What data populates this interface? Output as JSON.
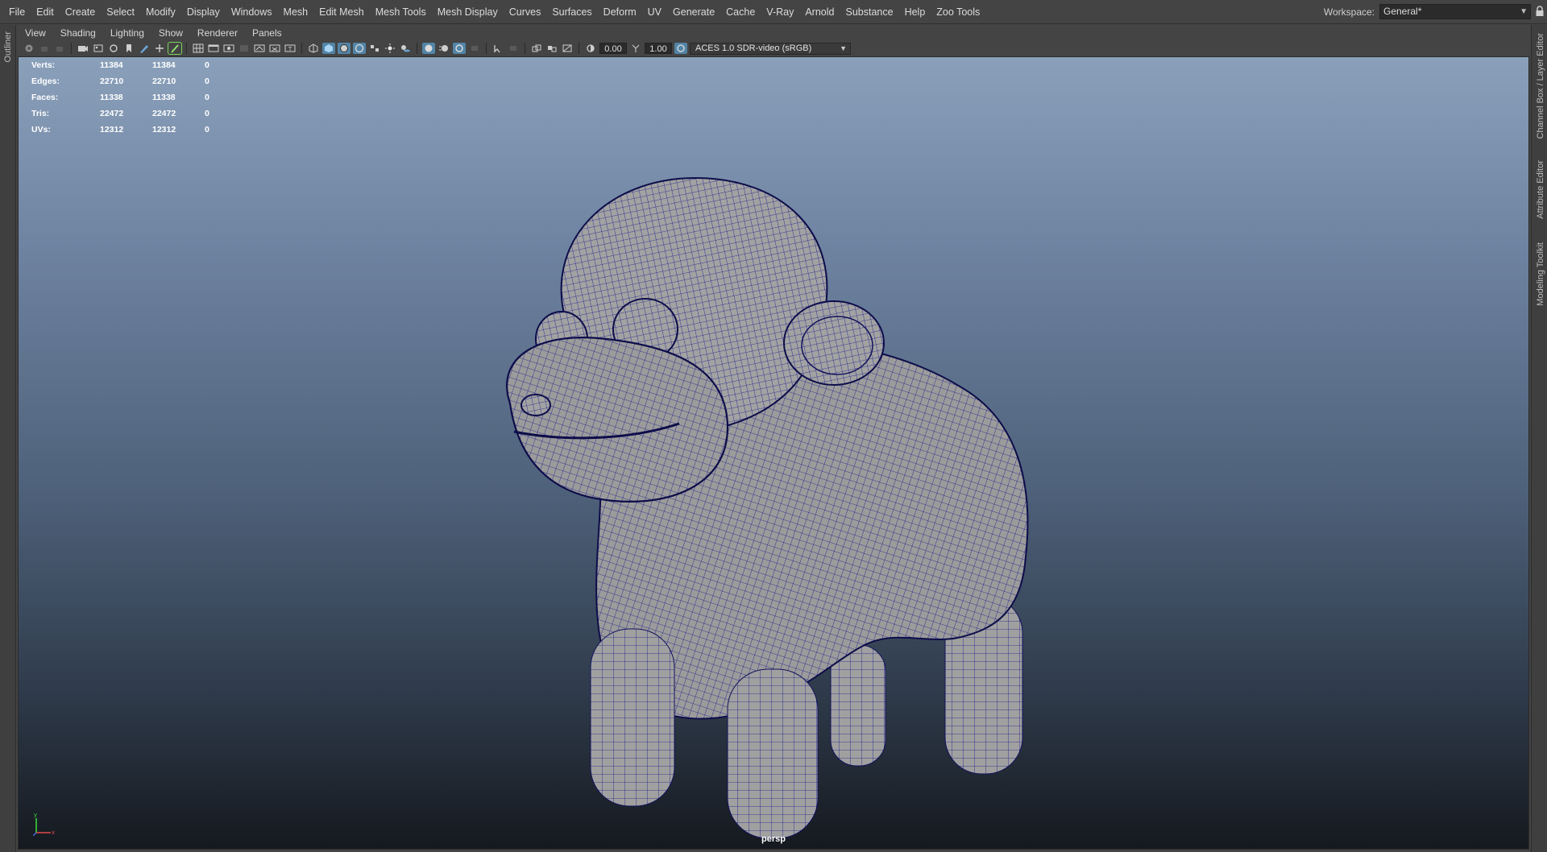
{
  "menubar": {
    "items": [
      "File",
      "Edit",
      "Create",
      "Select",
      "Modify",
      "Display",
      "Windows",
      "Mesh",
      "Edit Mesh",
      "Mesh Tools",
      "Mesh Display",
      "Curves",
      "Surfaces",
      "Deform",
      "UV",
      "Generate",
      "Cache",
      "V-Ray",
      "Arnold",
      "Substance",
      "Help",
      "Zoo Tools"
    ],
    "workspace_label": "Workspace:",
    "workspace_value": "General*"
  },
  "left_strip": {
    "tab_label": "Outliner"
  },
  "right_strip": {
    "tabs": [
      "Channel Box / Layer Editor",
      "Attribute Editor",
      "Modeling Toolkit"
    ]
  },
  "panel_menu": {
    "items": [
      "View",
      "Shading",
      "Lighting",
      "Show",
      "Renderer",
      "Panels"
    ]
  },
  "toolbar": {
    "exposure_value": "0.00",
    "gamma_value": "1.00",
    "color_space": "ACES 1.0 SDR-video (sRGB)"
  },
  "hud": {
    "rows": [
      {
        "label": "Verts:",
        "values": [
          "11384",
          "11384",
          "0"
        ]
      },
      {
        "label": "Edges:",
        "values": [
          "22710",
          "22710",
          "0"
        ]
      },
      {
        "label": "Faces:",
        "values": [
          "11338",
          "11338",
          "0"
        ]
      },
      {
        "label": "Tris:",
        "values": [
          "22472",
          "22472",
          "0"
        ]
      },
      {
        "label": "UVs:",
        "values": [
          "12312",
          "12312",
          "0"
        ]
      }
    ]
  },
  "viewport": {
    "camera_label": "persp"
  },
  "colors": {
    "wire": "#1b1b8f",
    "mesh": "#9a9a9a",
    "accent": "#5285a6"
  }
}
